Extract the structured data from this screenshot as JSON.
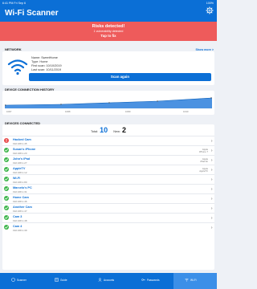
{
  "statusbar": {
    "time": "6:41 PM",
    "date": "Fri Sep 6",
    "battery": "100%"
  },
  "header": {
    "title": "Wi-Fi Scanner"
  },
  "alert": {
    "title": "Risks detected!",
    "subtitle": "1 vulnerability detected",
    "action": "Tap to fix"
  },
  "network": {
    "section_label": "NETWORK",
    "show_more": "Show more >",
    "name": "Name: SweetHome",
    "type": "Type: Home",
    "first_scan": "First scan: 10/10/2019",
    "last_scan": "Last scan: 10/11/2019",
    "scan_button": "Scan again"
  },
  "history": {
    "section_label": "DEVICE CONNECTION HISTORY",
    "x_labels": [
      "10/07",
      "10/08",
      "10/09",
      "10/10"
    ]
  },
  "devices": {
    "section_label": "DEVICES CONNECTED",
    "total_label": "Total:",
    "total": "10",
    "new_label": "New:",
    "new": "2",
    "items": [
      {
        "name": "Hacked Cam",
        "ip": "192.168.1.45",
        "vendor": "",
        "model": "",
        "status": "risk"
      },
      {
        "name": "Susan's iPhone",
        "ip": "192.168.1.23",
        "vendor": "Apple",
        "model": "iPhone 7",
        "status": "ok"
      },
      {
        "name": "John's iPad",
        "ip": "192.168.1.27",
        "vendor": "Apple",
        "model": "iPad Air",
        "status": "ok"
      },
      {
        "name": "AppleTV",
        "ip": "192.168.1.12",
        "vendor": "Apple",
        "model": "AppleTV",
        "status": "ok"
      },
      {
        "name": "Wi-Fi",
        "ip": "192.168.1.80",
        "vendor": "",
        "model": "",
        "status": "ok"
      },
      {
        "name": "Marcelo's PC",
        "ip": "192.168.1.31",
        "vendor": "",
        "model": "",
        "status": "ok"
      },
      {
        "name": "Home Cam",
        "ip": "192.168.1.46",
        "vendor": "",
        "model": "",
        "status": "ok"
      },
      {
        "name": "Another Cam",
        "ip": "192.168.1.47",
        "vendor": "",
        "model": "",
        "status": "ok"
      },
      {
        "name": "Cam 3",
        "ip": "192.168.1.48",
        "vendor": "",
        "model": "",
        "status": "ok"
      },
      {
        "name": "Cam 4",
        "ip": "192.168.1.39",
        "vendor": "",
        "model": "",
        "status": "ok"
      }
    ]
  },
  "tabs": [
    {
      "label": "Scanner",
      "icon": "shield-icon",
      "active": false
    },
    {
      "label": "Guide",
      "icon": "guide-icon",
      "active": false
    },
    {
      "label": "Accounts",
      "icon": "accounts-icon",
      "active": false
    },
    {
      "label": "Passwords",
      "icon": "key-icon",
      "active": false
    },
    {
      "label": "Wi-Fi",
      "icon": "wifi-icon",
      "active": true
    }
  ],
  "colors": {
    "primary": "#0b6fd6",
    "alert": "#ee5b5b",
    "ok": "#3bb54a",
    "risk": "#e84848"
  }
}
